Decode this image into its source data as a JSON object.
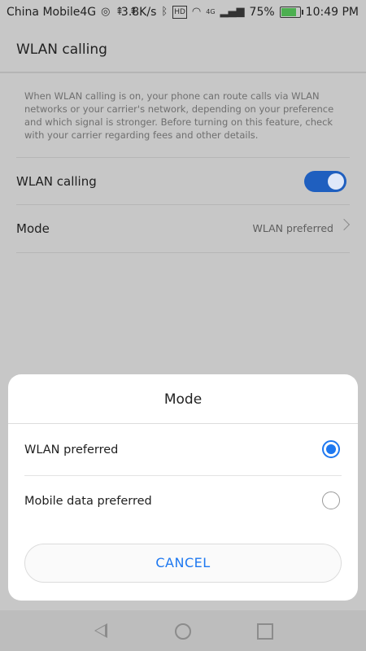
{
  "status_bar": {
    "carrier": "China Mobile4G",
    "speed": "3.8K/s",
    "hd_badge": "HD",
    "net_badge": "4G",
    "battery_percent": "75%",
    "battery_level": 0.75,
    "time": "10:49 PM"
  },
  "header": {
    "title": "WLAN calling"
  },
  "settings": {
    "description": "When WLAN calling is on, your phone can route calls via WLAN networks or your carrier's network, depending on your preference and which signal is stronger. Before turning on this feature, check with your carrier regarding fees and other details.",
    "wlan_calling_label": "WLAN calling",
    "wlan_calling_on": true,
    "mode_label": "Mode",
    "mode_value": "WLAN preferred"
  },
  "dialog": {
    "title": "Mode",
    "options": [
      {
        "label": "WLAN preferred",
        "selected": true
      },
      {
        "label": "Mobile data preferred",
        "selected": false
      }
    ],
    "cancel_label": "CANCEL"
  },
  "colors": {
    "accent": "#1e78f0",
    "toggle_on": "#1f5fbf",
    "scrim_background": "#c7c7c7"
  },
  "nav_bar": {
    "icons": [
      "back-icon",
      "home-icon",
      "recent-apps-icon"
    ]
  }
}
